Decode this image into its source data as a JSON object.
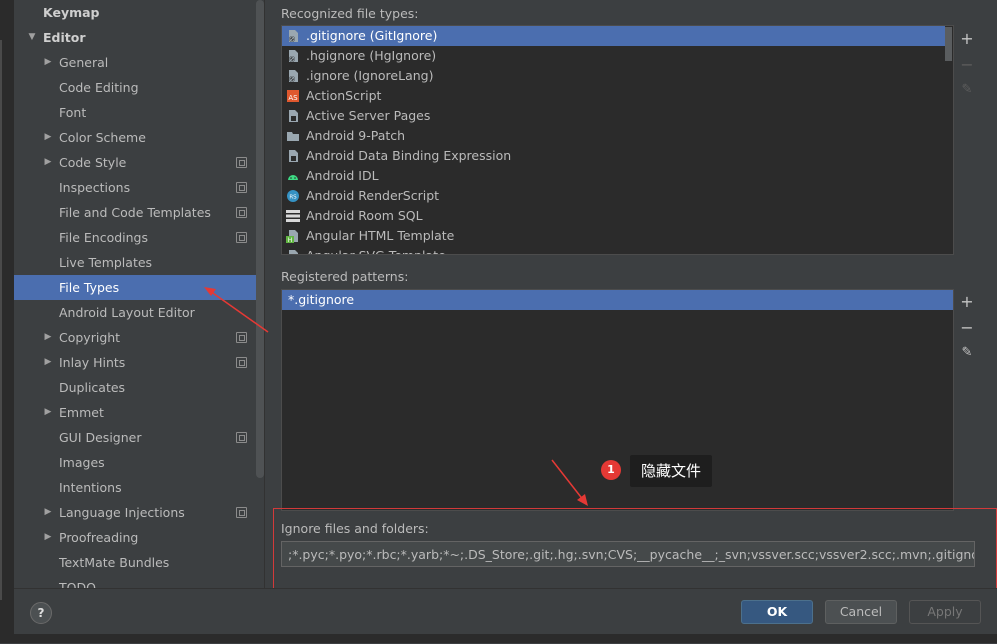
{
  "sidebar": {
    "items": [
      {
        "label": "Keymap",
        "bold": true,
        "arrow": "",
        "copy": false
      },
      {
        "label": "Editor",
        "bold": true,
        "arrow": "▼",
        "copy": false
      },
      {
        "label": "General",
        "arrow": "▶",
        "copy": false
      },
      {
        "label": "Code Editing",
        "arrow": "",
        "copy": false
      },
      {
        "label": "Font",
        "arrow": "",
        "copy": false
      },
      {
        "label": "Color Scheme",
        "arrow": "▶",
        "copy": false
      },
      {
        "label": "Code Style",
        "arrow": "▶",
        "copy": true
      },
      {
        "label": "Inspections",
        "arrow": "",
        "copy": true
      },
      {
        "label": "File and Code Templates",
        "arrow": "",
        "copy": true
      },
      {
        "label": "File Encodings",
        "arrow": "",
        "copy": true
      },
      {
        "label": "Live Templates",
        "arrow": "",
        "copy": false
      },
      {
        "label": "File Types",
        "arrow": "",
        "copy": false,
        "selected": true
      },
      {
        "label": "Android Layout Editor",
        "arrow": "",
        "copy": false
      },
      {
        "label": "Copyright",
        "arrow": "▶",
        "copy": true
      },
      {
        "label": "Inlay Hints",
        "arrow": "▶",
        "copy": true
      },
      {
        "label": "Duplicates",
        "arrow": "",
        "copy": false
      },
      {
        "label": "Emmet",
        "arrow": "▶",
        "copy": false
      },
      {
        "label": "GUI Designer",
        "arrow": "",
        "copy": true
      },
      {
        "label": "Images",
        "arrow": "",
        "copy": false
      },
      {
        "label": "Intentions",
        "arrow": "",
        "copy": false
      },
      {
        "label": "Language Injections",
        "arrow": "▶",
        "copy": true
      },
      {
        "label": "Proofreading",
        "arrow": "▶",
        "copy": false
      },
      {
        "label": "TextMate Bundles",
        "arrow": "",
        "copy": false
      },
      {
        "label": "TODO",
        "arrow": "",
        "copy": false
      }
    ]
  },
  "file_types": {
    "label": "Recognized file types:",
    "items": [
      {
        "label": ".gitignore (GitIgnore)",
        "icon": "file-ignore-icon",
        "color": "#9aa7b0",
        "selected": true
      },
      {
        "label": ".hgignore (HgIgnore)",
        "icon": "file-ignore-icon",
        "color": "#9aa7b0"
      },
      {
        "label": ".ignore (IgnoreLang)",
        "icon": "file-ignore-icon",
        "color": "#9aa7b0"
      },
      {
        "label": "ActionScript",
        "icon": "actionscript-icon",
        "color": "#e0582e"
      },
      {
        "label": "Active Server Pages",
        "icon": "file-icon",
        "color": "#9aa7b0"
      },
      {
        "label": "Android 9-Patch",
        "icon": "folder-icon",
        "color": "#9aa7b0"
      },
      {
        "label": "Android Data Binding Expression",
        "icon": "file-icon",
        "color": "#9aa7b0"
      },
      {
        "label": "Android IDL",
        "icon": "android-icon",
        "color": "#3ddc84"
      },
      {
        "label": "Android RenderScript",
        "icon": "renderscript-icon",
        "color": "#3592c4"
      },
      {
        "label": "Android Room SQL",
        "icon": "database-icon",
        "color": "#d8d8d8"
      },
      {
        "label": "Angular HTML Template",
        "icon": "angular-html-icon",
        "color": "#62b543"
      },
      {
        "label": "Angular SVG Template",
        "icon": "file-icon",
        "color": "#9aa7b0"
      }
    ]
  },
  "patterns": {
    "label": "Registered patterns:",
    "items": [
      {
        "label": "*.gitignore",
        "selected": true
      }
    ]
  },
  "toolbar": {
    "add": "+",
    "remove": "−",
    "edit": "✎"
  },
  "ignore": {
    "label": "Ignore files and folders:",
    "value": ";*.pyc;*.pyo;*.rbc;*.yarb;*~;.DS_Store;.git;.hg;.svn;CVS;__pycache__;_svn;vssver.scc;vssver2.scc;.mvn;.gitignore;*.iml;*.cmd;"
  },
  "annotation": {
    "badge": "1",
    "text": "隐藏文件",
    "accent": "#e53935"
  },
  "buttons": {
    "help": "?",
    "ok": "OK",
    "cancel": "Cancel",
    "apply": "Apply"
  }
}
